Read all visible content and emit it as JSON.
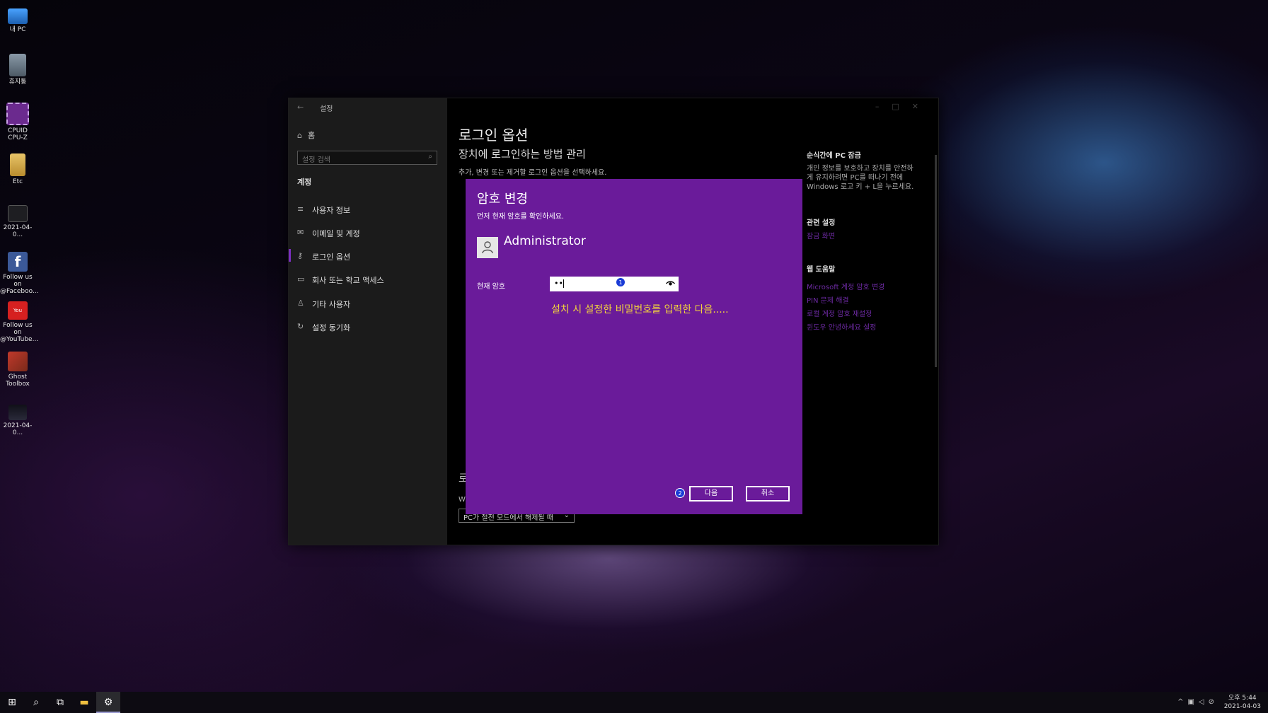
{
  "desktop": {
    "icons": [
      {
        "label": "내 PC"
      },
      {
        "label": "휴지통"
      },
      {
        "label": "CPUID CPU-Z"
      },
      {
        "label": "Etc"
      },
      {
        "label": "2021-04-0..."
      },
      {
        "label": "Follow us on @Faceboo..."
      },
      {
        "label": "Follow us on @YouTube..."
      },
      {
        "label": "Ghost Toolbox"
      },
      {
        "label": "2021-04-0..."
      }
    ]
  },
  "settings": {
    "window_title": "설정",
    "back_glyph": "←",
    "sidebar": {
      "home": "홈",
      "search_placeholder": "설정 검색",
      "section": "계정",
      "items": [
        {
          "label": "사용자 정보",
          "icon": "user-info-icon"
        },
        {
          "label": "이메일 및 계정",
          "icon": "mail-icon"
        },
        {
          "label": "로그인 옵션",
          "icon": "key-icon"
        },
        {
          "label": "회사 또는 학교 액세스",
          "icon": "briefcase-icon"
        },
        {
          "label": "기타 사용자",
          "icon": "person-icon"
        },
        {
          "label": "설정 동기화",
          "icon": "sync-icon"
        }
      ]
    },
    "main": {
      "title": "로그인 옵션",
      "subtitle": "장치에 로그인하는 방법 관리",
      "description": "추가, 변경 또는 제거할 로그인 옵션을 선택하세요.",
      "partial_label": "로",
      "partial_label2": "W",
      "dropdown_value": "PC가 절전 모드에서 해제될 때"
    },
    "right_panel": {
      "lock_heading": "순식간에 PC 잠금",
      "lock_text": [
        "개인 정보를 보호하고 장치를 안전하",
        "게 유지하려면 PC를 떠나기 전에",
        "Windows 로고 키 + L을 누르세요."
      ],
      "related_heading": "관련 설정",
      "related_link": "잠금 화면",
      "help_heading": "웹 도움말",
      "help_links": [
        "Microsoft 계정 암호 변경",
        "PIN 문제 해결",
        "로컬 계정 암호 재설정",
        "윈도우 안녕하세요 설정"
      ]
    }
  },
  "dialog": {
    "title": "암호 변경",
    "subtitle": "먼저 현재 암호를 확인하세요.",
    "username": "Administrator",
    "password_label": "현재 암호",
    "password_value": "••",
    "note": "설치 시 설정한 비밀번호를 입력한 다음.....",
    "badge1": "1",
    "badge2": "2",
    "next_button": "다음",
    "cancel_button": "취소",
    "accent_color": "#6a1b9a",
    "note_color": "#f4d63b"
  },
  "taskbar": {
    "time": "오후 5:44",
    "date": "2021-04-03"
  }
}
